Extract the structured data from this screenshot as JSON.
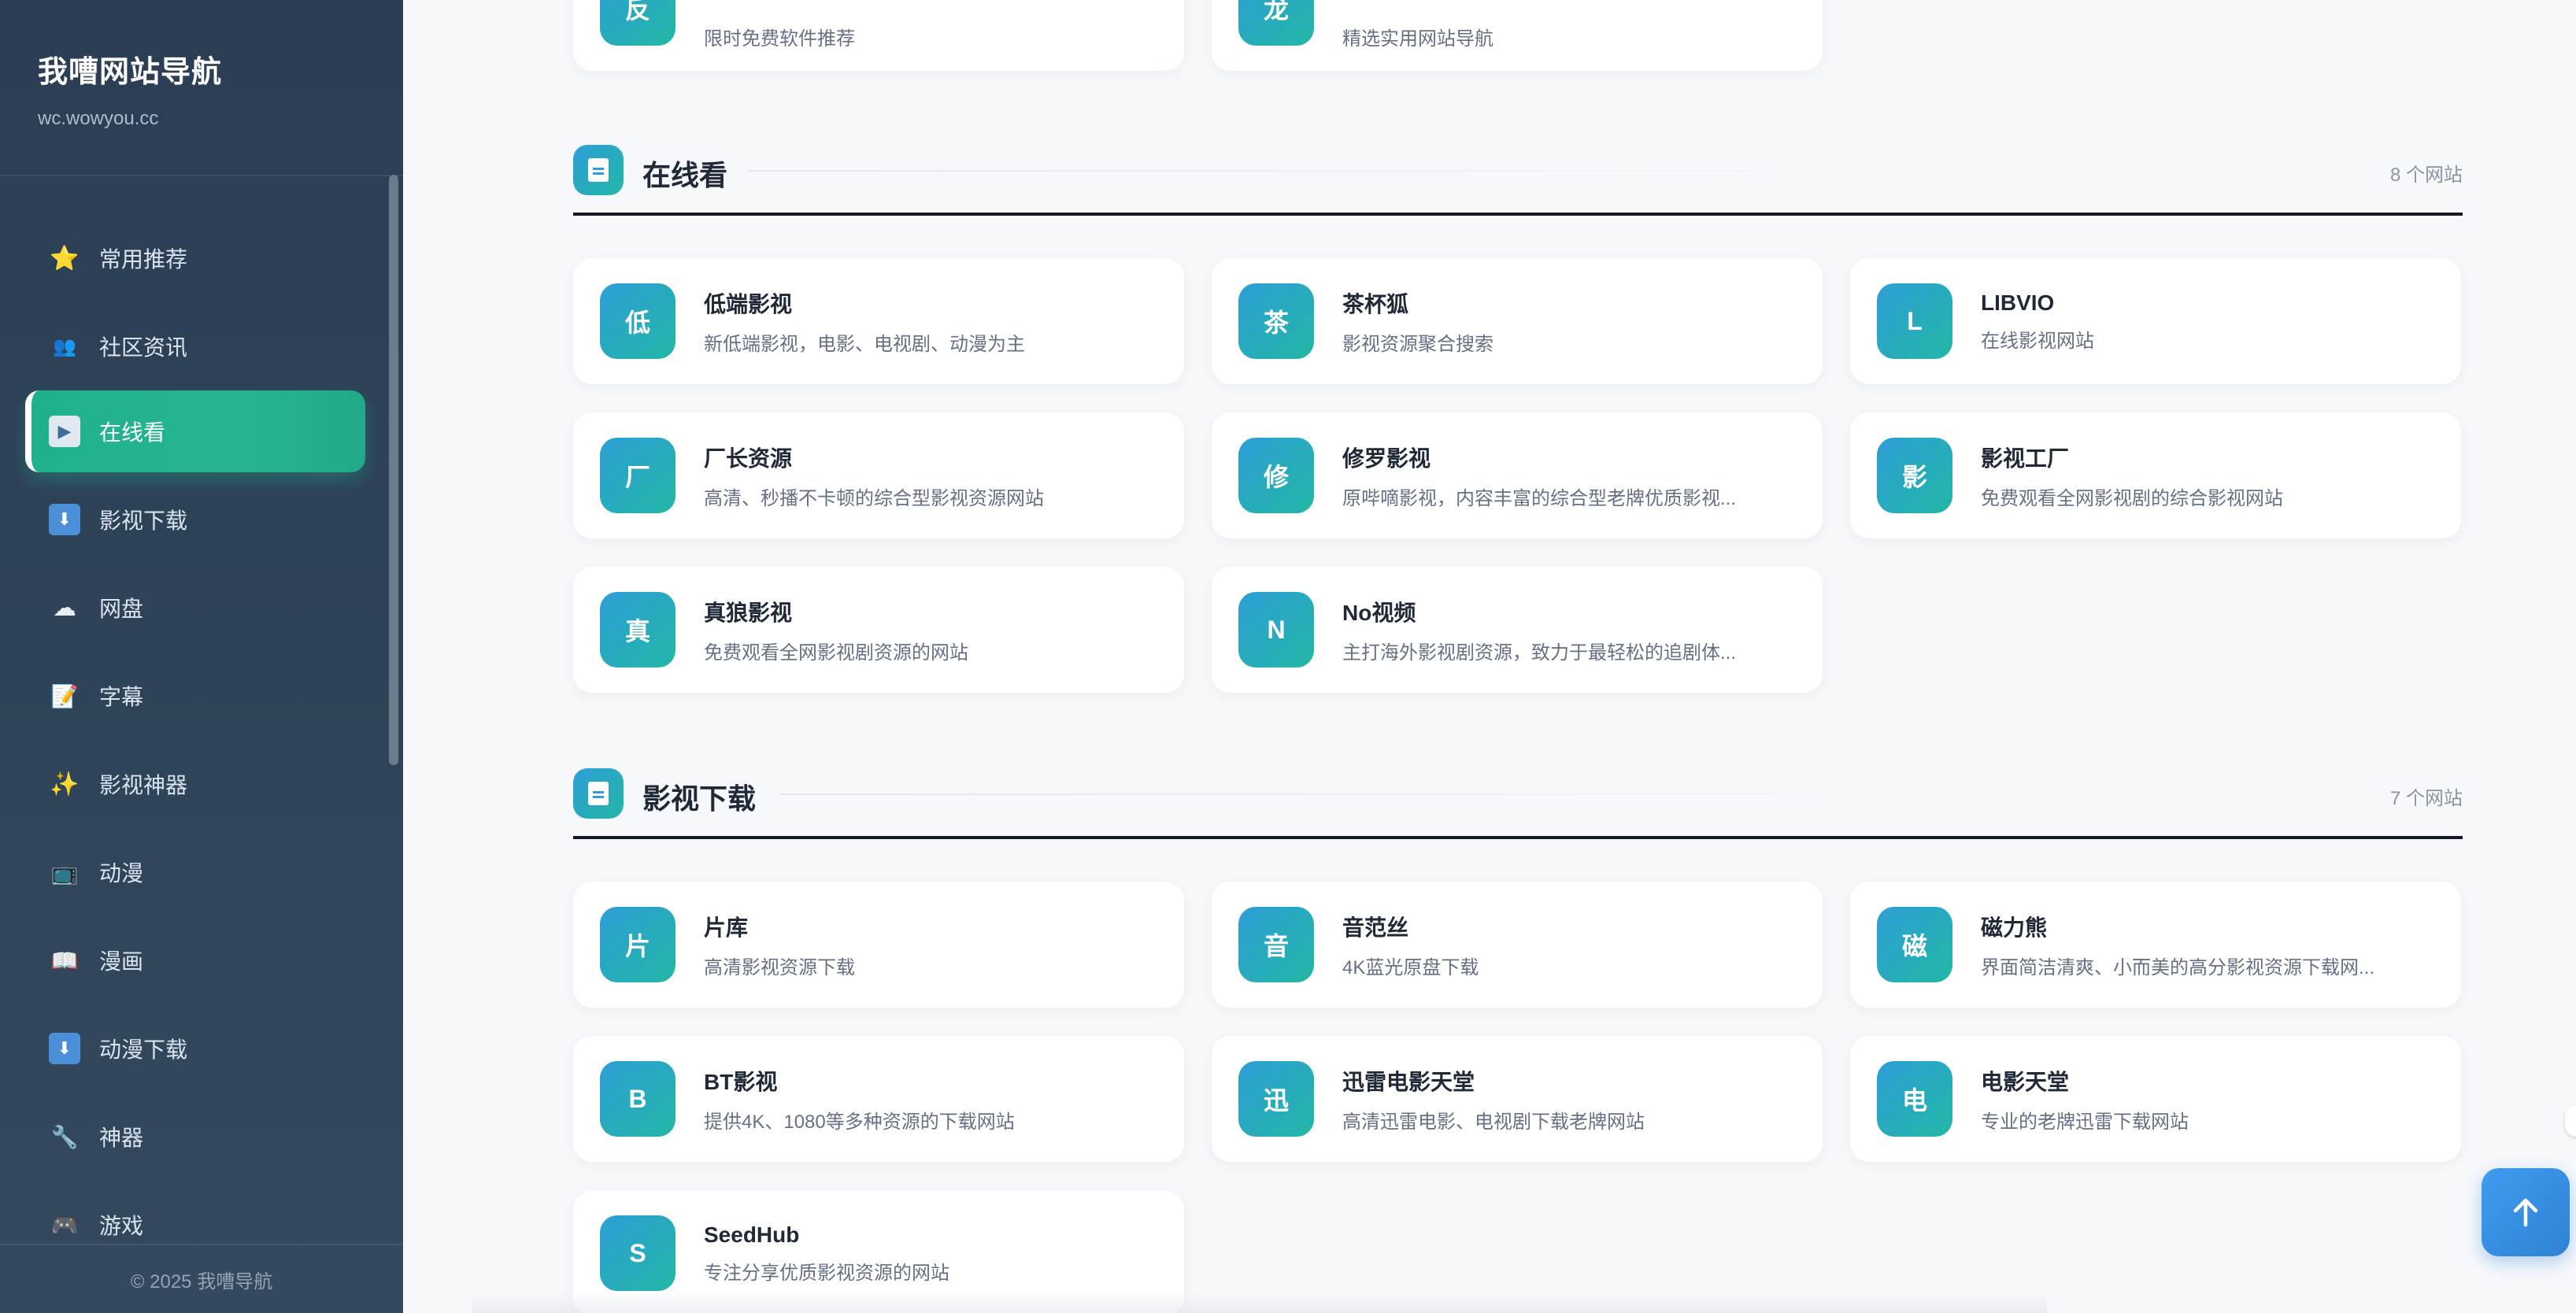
{
  "sidebar": {
    "title": "我嘈网站导航",
    "subtitle": "wc.wowyou.cc",
    "items": [
      {
        "icon": "star-icon",
        "glyph": "⭐",
        "label": "常用推荐"
      },
      {
        "icon": "people-icon",
        "glyph": "👥",
        "label": "社区资讯"
      },
      {
        "icon": "play-icon",
        "glyph": "▶",
        "label": "在线看",
        "active": true
      },
      {
        "icon": "download-icon",
        "glyph": "⬇",
        "label": "影视下载"
      },
      {
        "icon": "cloud-icon",
        "glyph": "☁",
        "label": "网盘"
      },
      {
        "icon": "memo-icon",
        "glyph": "📝",
        "label": "字幕"
      },
      {
        "icon": "sparkles-icon",
        "glyph": "✨",
        "label": "影视神器"
      },
      {
        "icon": "tv-icon",
        "glyph": "📺",
        "label": "动漫"
      },
      {
        "icon": "book-icon",
        "glyph": "📖",
        "label": "漫画"
      },
      {
        "icon": "download-icon",
        "glyph": "⬇",
        "label": "动漫下载"
      },
      {
        "icon": "wrench-icon",
        "glyph": "🔧",
        "label": "神器"
      },
      {
        "icon": "gamepad-icon",
        "glyph": "🎮",
        "label": "游戏"
      }
    ],
    "footer": "© 2025 我嘈导航"
  },
  "top_partial": [
    {
      "avatar": "反",
      "desc": "限时免费软件推荐"
    },
    {
      "avatar": "龙",
      "desc": "精选实用网站导航"
    }
  ],
  "sections": [
    {
      "title": "在线看",
      "count": "8 个网站",
      "cards": [
        {
          "avatar": "低",
          "title": "低端影视",
          "desc": "新低端影视，电影、电视剧、动漫为主"
        },
        {
          "avatar": "茶",
          "title": "茶杯狐",
          "desc": "影视资源聚合搜索"
        },
        {
          "avatar": "L",
          "title": "LIBVIO",
          "desc": "在线影视网站"
        },
        {
          "avatar": "厂",
          "title": "厂长资源",
          "desc": "高清、秒播不卡顿的综合型影视资源网站"
        },
        {
          "avatar": "修",
          "title": "修罗影视",
          "desc": "原哔嘀影视，内容丰富的综合型老牌优质影视..."
        },
        {
          "avatar": "影",
          "title": "影视工厂",
          "desc": "免费观看全网影视剧的综合影视网站"
        },
        {
          "avatar": "真",
          "title": "真狼影视",
          "desc": "免费观看全网影视剧资源的网站"
        },
        {
          "avatar": "N",
          "title": "No视频",
          "desc": "主打海外影视剧资源，致力于最轻松的追剧体..."
        }
      ]
    },
    {
      "title": "影视下载",
      "count": "7 个网站",
      "cards": [
        {
          "avatar": "片",
          "title": "片库",
          "desc": "高清影视资源下载"
        },
        {
          "avatar": "音",
          "title": "音范丝",
          "desc": "4K蓝光原盘下载"
        },
        {
          "avatar": "磁",
          "title": "磁力熊",
          "desc": "界面简洁清爽、小而美的高分影视资源下载网..."
        },
        {
          "avatar": "B",
          "title": "BT影视",
          "desc": "提供4K、1080等多种资源的下载网站"
        },
        {
          "avatar": "迅",
          "title": "迅雷电影天堂",
          "desc": "高清迅雷电影、电视剧下载老牌网站"
        },
        {
          "avatar": "电",
          "title": "电影天堂",
          "desc": "专业的老牌迅雷下载网站"
        },
        {
          "avatar": "S",
          "title": "SeedHub",
          "desc": "专注分享优质影视资源的网站"
        }
      ]
    }
  ],
  "back_to_top": {
    "icon": "arrow-up-icon"
  },
  "colors": {
    "sidebar_bg": "#2f4358",
    "active": "#1fb08d",
    "avatar_from": "#2e9ed6",
    "avatar_to": "#22b7a6",
    "top_button": "#3a92e6"
  }
}
